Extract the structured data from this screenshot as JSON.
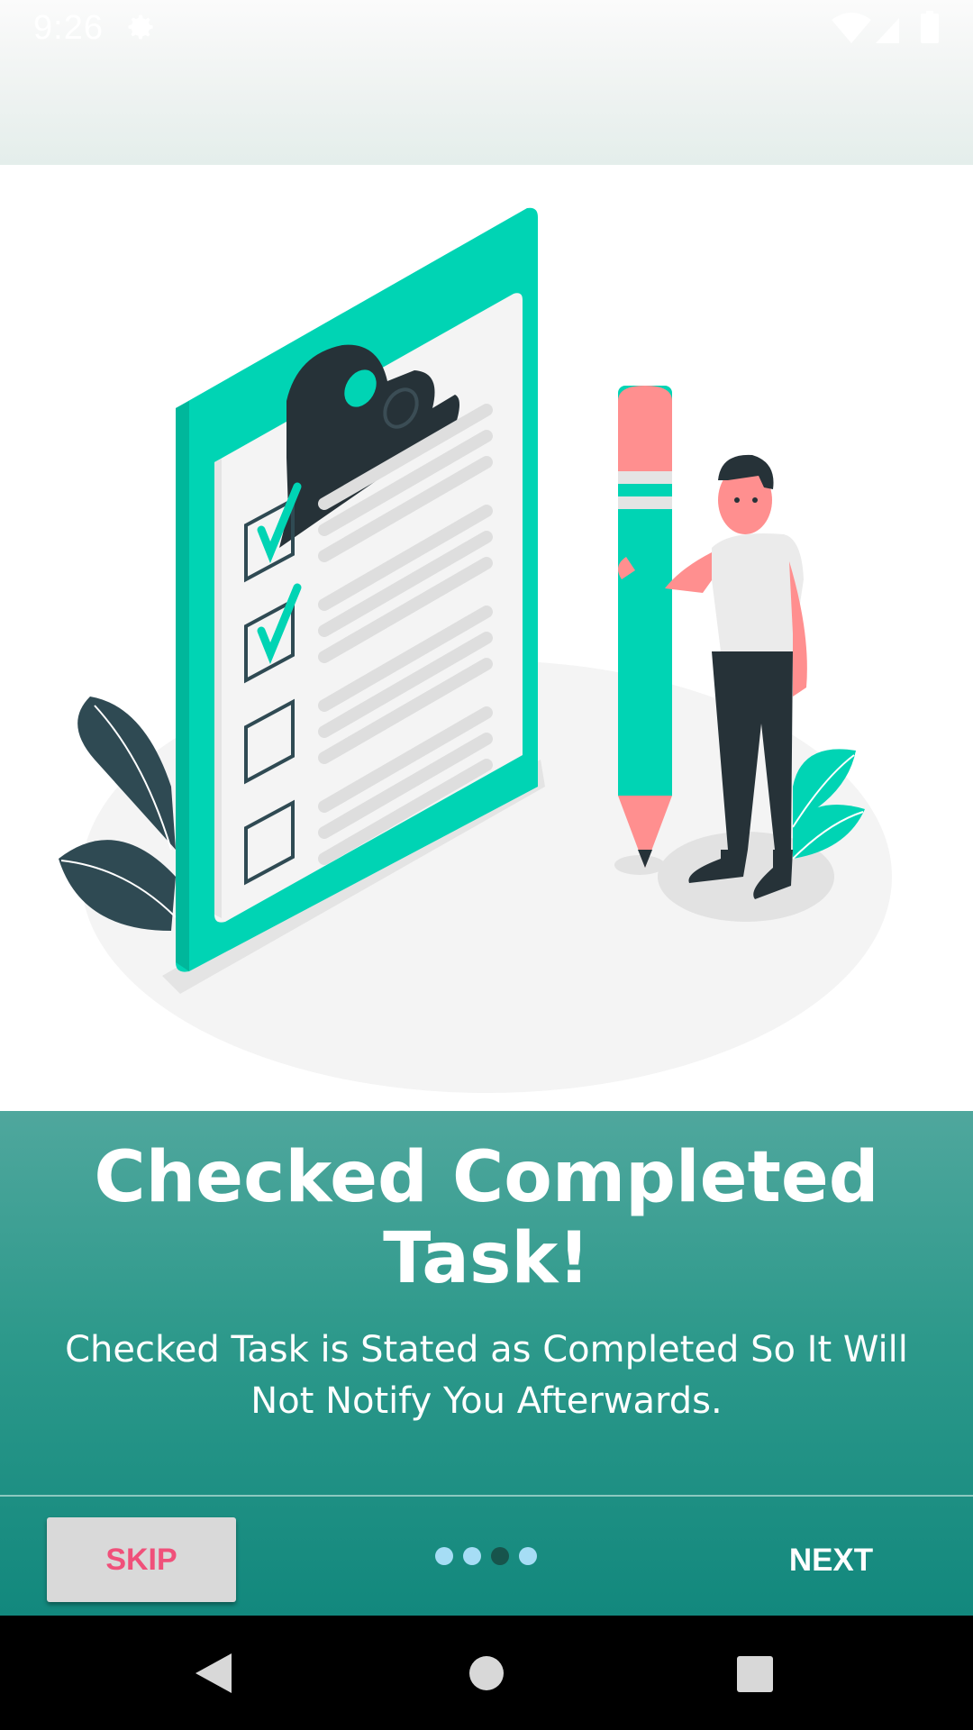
{
  "status_bar": {
    "time": "9:26",
    "icons": [
      "gear-icon",
      "wifi-icon",
      "signal-icon",
      "battery-icon"
    ]
  },
  "illustration": {
    "description_icon": "clipboard-checklist-illustration"
  },
  "onboarding": {
    "title": "Checked Completed Task!",
    "description": "Checked Task is Stated as Completed So It Will Not Notify You Afterwards.",
    "page_indicator": {
      "total": 4,
      "current": 3
    }
  },
  "footer": {
    "skip_label": "SKIP",
    "next_label": "NEXT"
  },
  "colors": {
    "accent": "#00d4b4",
    "panel": "#2d998b",
    "skip_text": "#f0507a"
  }
}
